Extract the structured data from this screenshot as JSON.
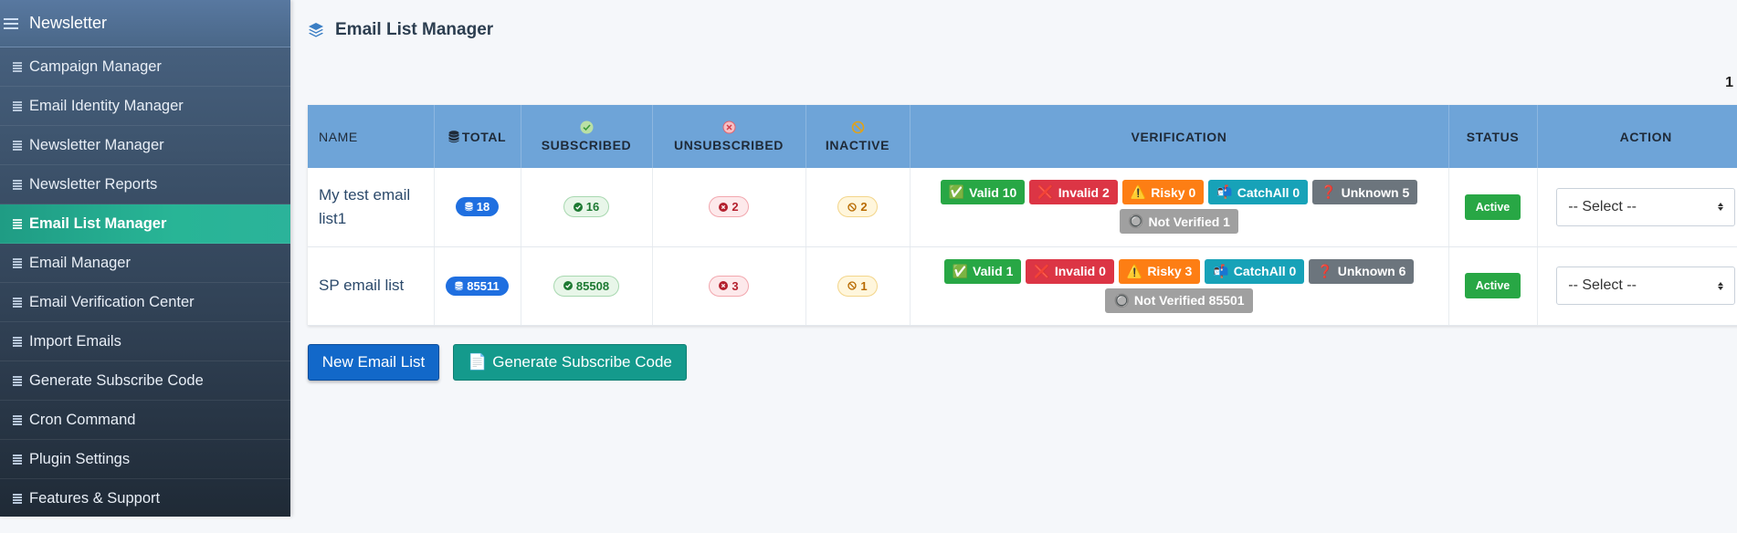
{
  "sidebar": {
    "title": "Newsletter",
    "items": [
      {
        "label": "Campaign Manager"
      },
      {
        "label": "Email Identity Manager"
      },
      {
        "label": "Newsletter Manager"
      },
      {
        "label": "Newsletter Reports"
      },
      {
        "label": "Email List Manager",
        "active": true
      },
      {
        "label": "Email Manager"
      },
      {
        "label": "Email Verification Center"
      },
      {
        "label": "Import Emails"
      },
      {
        "label": "Generate Subscribe Code"
      },
      {
        "label": "Cron Command"
      },
      {
        "label": "Plugin Settings"
      },
      {
        "label": "Features & Support"
      }
    ]
  },
  "page": {
    "title": "Email List Manager",
    "page_number": "1"
  },
  "table": {
    "headers": {
      "name": "Name",
      "total": "Total",
      "subscribed": "Subscribed",
      "unsubscribed": "Unsubscribed",
      "inactive": "Inactive",
      "verification": "Verification",
      "status": "Status",
      "action": "Action"
    },
    "rows": [
      {
        "name": "My test email list1",
        "total": "18",
        "subscribed": "16",
        "unsubscribed": "2",
        "inactive": "2",
        "verification": {
          "valid": "Valid 10",
          "invalid": "Invalid 2",
          "risky": "Risky 0",
          "catchall": "CatchAll 0",
          "unknown": "Unknown 5",
          "not_verified": "Not Verified 1"
        },
        "status": "Active",
        "action": "-- Select --"
      },
      {
        "name": "SP email list",
        "total": "85511",
        "subscribed": "85508",
        "unsubscribed": "3",
        "inactive": "1",
        "verification": {
          "valid": "Valid 1",
          "invalid": "Invalid 0",
          "risky": "Risky 3",
          "catchall": "CatchAll 0",
          "unknown": "Unknown 6",
          "not_verified": "Not Verified 85501"
        },
        "status": "Active",
        "action": "-- Select --"
      }
    ]
  },
  "buttons": {
    "new_list": "New Email List",
    "generate": "Generate Subscribe Code"
  },
  "icons": {
    "valid": "✅",
    "invalid": "❌",
    "risky": "⚠️",
    "catchall": "📬",
    "unknown": "❓",
    "not_verified": "🔘",
    "generate": "📄"
  },
  "colors": {
    "header_bg": "#6ea4d8",
    "active_sidebar": "#28b596",
    "primary_button": "#1268c9",
    "teal_button": "#149a8c"
  }
}
